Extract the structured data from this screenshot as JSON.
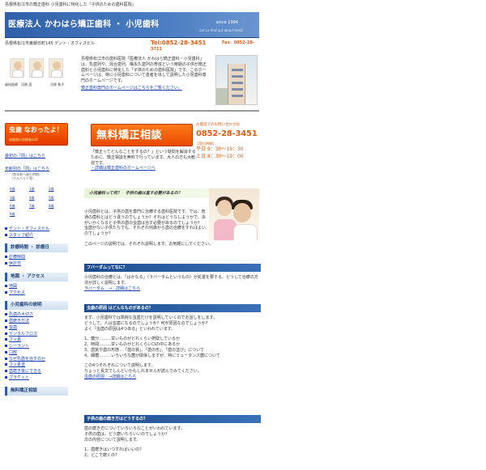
{
  "top_line": "島根県松江市の矯正歯科 小児歯科に特化した「子供のための歯科医院」",
  "header": {
    "title": "医療法人 かわはら矯正歯科 ・ 小児歯科",
    "since": "since 1994",
    "tagline": "Let us find out about teeth"
  },
  "address": {
    "line": "島根県松江市東朝日町145 デント・オフィスビル",
    "tel": "Tel:0852-28-3451",
    "fax": "Fax：0852-28-",
    "fax_cont": "3711"
  },
  "intro": {
    "captions": [
      "歯科医師　河原 茂",
      "河原 和子"
    ],
    "text": "島根県松江市の歯科医院「医療法人 かわはら矯正歯科・小児歯科」は、乳歯列や、混合歯列、構永久歯列の育成という時期の子供が矯正歯科と小児歯科に特化した「子供のための歯科医院」です。このホームページは、特に小児歯科について患者を出して説明した小児歯科専門のホームページです。",
    "more_link": "矯正歯科専門のホームページはこちらをご覧ください。"
  },
  "sidebar": {
    "banner_title": "虫歯 なおったよ！",
    "banner_sub": "幼稚園の治療者の声",
    "link_first": "最初の「問」はこちら",
    "link_age": "年齢別の「問」はこちら",
    "link_age_sub1": "（各年齢へ進む時期）",
    "link_age_sub2": "（アルバイト等）",
    "ages": [
      "0歳",
      "1歳",
      "2歳",
      "3歳",
      "4歳",
      "5歳",
      "6歳",
      "7歳",
      "8歳",
      "9歳"
    ],
    "office_link": "デント・オフィスビル",
    "staff_link": "スタッフ紹介",
    "section_hours": "診療時間 ・ 診療日",
    "hours_links": [
      "診療時間",
      "休診日"
    ],
    "section_access": "地図 ・ アクセス",
    "access_links": [
      "地図",
      "アクセス"
    ],
    "section_kids": "小児歯科の説明",
    "kids_links": [
      "乳歯の大切さ",
      "歯磨き方法",
      "虫歯",
      "デンタルフロス",
      "フッ素",
      "シーラント",
      "口腔",
      "なぜ乳歯を治すのか",
      "フッ素塗",
      "歯磨き後にできる",
      "プラケット"
    ],
    "section_free": "無料矯正相談"
  },
  "free": {
    "banner": "無料矯正相談",
    "contact_label": "お電話でのお問い合わせは",
    "tel": "0852-28-3451",
    "hours_label": "【受付時間】",
    "weekday": "平日 9：30～19：30",
    "saturday": "土日 8：30～19：00",
    "text": "「矯正ってどんなことをするの？」という疑問を解消するために、矯正相談を無料で行っています。大人の方も大歓迎です。",
    "link": "・詳細は矯正歯科のホームページへ"
  },
  "kids": {
    "banner": "小児歯科って何？　子供の歯は直す必要があるの？",
    "text1": "小児歯科とは、子供の歯を専門に治療する歯科医院です。では、普通の歯科とはどう違うのでしょうか？それはどうなしようかで、決がいかくなると子供の歯の虫歯は治す必要があるのでしょうか？　虫歯がない子供たちでも、それぞれ何歳から歯の治療をすればよいのでしょうか？",
    "text2": "このページの説明では、それぞれ説明します。お気軽にしてください。",
    "sec1_bar": "フバーダムってなに？",
    "sec1_text": "小児歯科の治療とは、「はかなる」（ラバーダムというもの）が処置を要する。どうして治療の方法が詳しく説明します。",
    "sec1_link": "ラバーダム　→　詳細はこちら",
    "sec2_bar": "虫歯の原因 はどんなものがあるの？",
    "sec2_lines": [
      "まず、小児歯科では単純な虫歯だけを説明していくのでお話しをします。",
      "どうして、人は虫歯になるのでしょうか？何が原因なのでしょうか？",
      "よく「虫歯の原因は4つある」といわれています。"
    ],
    "sec2_list": [
      "1、糖分………甘いものがどれくらい摂取しているか",
      "2、時間………甘いものがどれくらい口の中にあるか",
      "3、歯質や歯の形態…「歯の質」、「歯の形」、「歯の並び」について",
      "4、細菌………いろいろな菌が関係しますが、特にミュータンス菌について"
    ],
    "sec2_tail": [
      "この4つそれぞれについて説明します。",
      "ちょっと長文でしんどいかもしれませんが読んでみてください。"
    ],
    "sec2_link": "虫歯の原因　→詳細はこちら",
    "sec3_bar": "子供の歯の磨き方はどうするの？",
    "sec3_lines": [
      "歯の磨き方についていろいろなことがいわれています。",
      "子供の歯は、どう磨いたらいいのでしょうか？",
      "次の内容について説明します。"
    ],
    "sec3_list": [
      "1、歯磨きはいつすればいいの？",
      "2、どこで磨くの？"
    ]
  }
}
